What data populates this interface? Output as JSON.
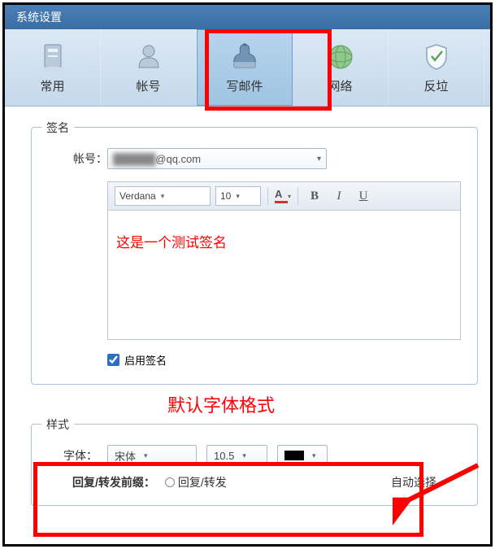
{
  "title": "系统设置",
  "tabs": {
    "common": "常用",
    "account": "帐号",
    "compose": "写邮件",
    "network": "网络",
    "antispam": "反垃"
  },
  "signature": {
    "legend": "签名",
    "account_label": "帐号：",
    "account_value": "@qq.com",
    "toolbar": {
      "font": "Verdana",
      "size": "10",
      "bold": "B",
      "italic": "I",
      "underline": "U",
      "textcolor_letter": "A"
    },
    "content": "这是一个测试签名",
    "enable_label": "启用签名",
    "enable_checked": true
  },
  "annotation": "默认字体格式",
  "style": {
    "legend": "样式",
    "font_label": "字体：",
    "font_value": "宋体",
    "size_value": "10.5",
    "color_value": "#000000"
  },
  "bottom_cut": {
    "label_fragment": "回复/转发前缀：",
    "opt1_fragment": "回复/转发",
    "opt_right": "自动选择"
  }
}
